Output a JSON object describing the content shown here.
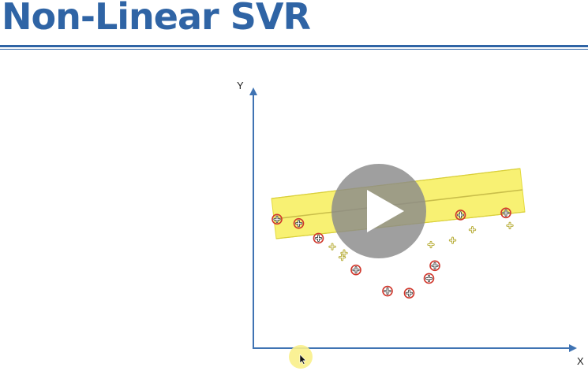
{
  "slide": {
    "title": "Non-Linear SVR"
  },
  "colors": {
    "title": "#2f64a5",
    "axis": "#3f73b3",
    "tube_fill": "#f7ee5a",
    "outlier_ring": "#d0372c",
    "cursor_highlight": "#f9f08a"
  },
  "chart_data": {
    "type": "scatter",
    "title": "",
    "xlabel": "X",
    "ylabel": "Y",
    "grid": false,
    "legend": "none",
    "note": "",
    "regression_line": "straight epsilon-insensitive tube rising slightly left to right",
    "points_outside_tube": [
      {
        "x": 1.2,
        "y": 6.1
      },
      {
        "x": 2.3,
        "y": 5.9
      },
      {
        "x": 3.3,
        "y": 5.2
      },
      {
        "x": 5.2,
        "y": 3.7
      },
      {
        "x": 6.8,
        "y": 2.7
      },
      {
        "x": 7.9,
        "y": 2.6
      },
      {
        "x": 8.9,
        "y": 3.3
      },
      {
        "x": 9.2,
        "y": 3.9
      },
      {
        "x": 10.5,
        "y": 6.3
      },
      {
        "x": 12.8,
        "y": 6.4
      }
    ],
    "points_inside_tube": [
      {
        "x": 4.0,
        "y": 4.8
      },
      {
        "x": 4.5,
        "y": 4.3
      },
      {
        "x": 4.6,
        "y": 4.5
      },
      {
        "x": 9.0,
        "y": 4.9
      },
      {
        "x": 10.1,
        "y": 5.1
      },
      {
        "x": 11.1,
        "y": 5.6
      },
      {
        "x": 13.0,
        "y": 5.8
      }
    ]
  },
  "player": {
    "play_icon": "play-icon",
    "cursor_icon": "pointer-cursor-icon"
  }
}
